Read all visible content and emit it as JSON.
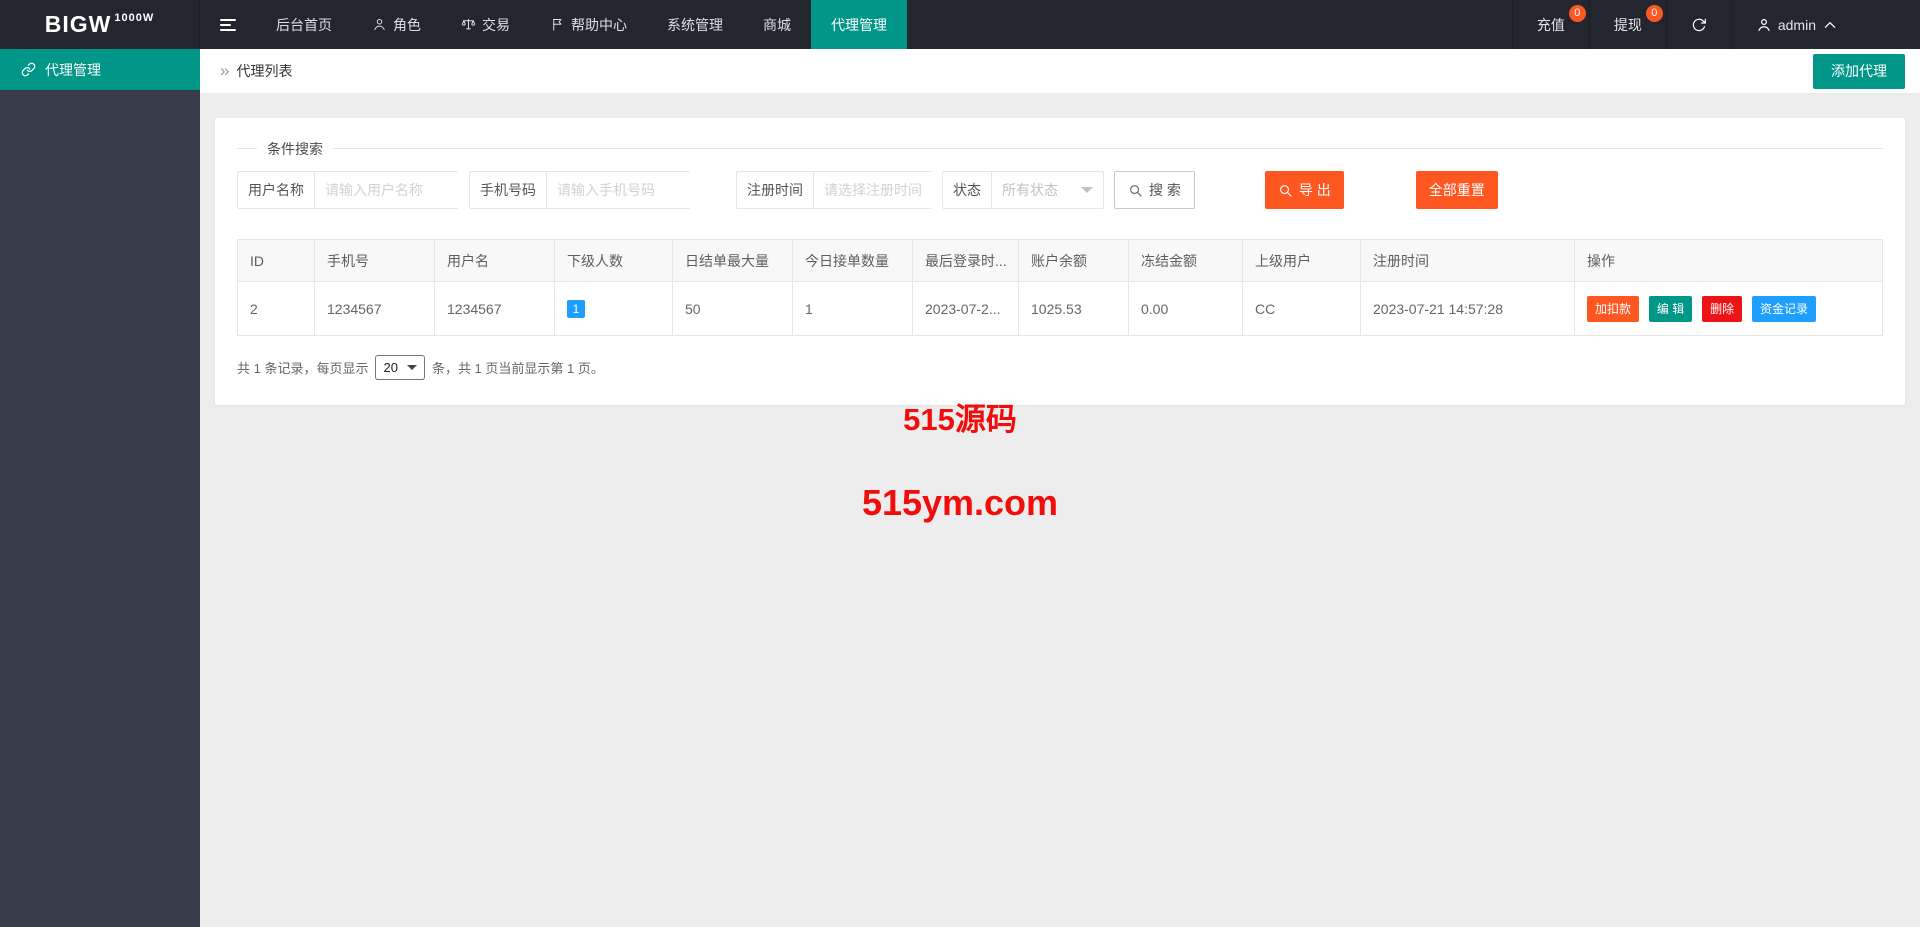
{
  "colors": {
    "accent_teal": "#009688",
    "accent_orange": "#FF5722",
    "accent_blue": "#1E9FFF",
    "accent_red": "#EC1414",
    "header_dark": "#23262E",
    "sidebar_dark": "#393D49",
    "watermark_red": "#F20D0D"
  },
  "brand": {
    "name": "BIGW",
    "superscript": "1000W"
  },
  "topnav": {
    "items": [
      {
        "label": "后台首页",
        "icon": "none"
      },
      {
        "label": "角色",
        "icon": "user-icon"
      },
      {
        "label": "交易",
        "icon": "scales-icon"
      },
      {
        "label": "帮助中心",
        "icon": "flag-icon"
      },
      {
        "label": "系统管理",
        "icon": "none"
      },
      {
        "label": "商城",
        "icon": "none"
      },
      {
        "label": "代理管理",
        "icon": "none",
        "active": true
      }
    ],
    "right": {
      "recharge": {
        "label": "充值",
        "badge": "0"
      },
      "withdraw": {
        "label": "提现",
        "badge": "0"
      },
      "refresh_icon": "refresh-icon",
      "user": {
        "icon": "user-icon",
        "name": "admin",
        "chevron": "chevron-up-icon"
      }
    }
  },
  "sidebar": {
    "items": [
      {
        "label": "代理管理",
        "icon": "link-icon",
        "active": true
      }
    ]
  },
  "toolbar": {
    "breadcrumb_icon": "»",
    "breadcrumb": "代理列表",
    "add_button": "添加代理"
  },
  "search": {
    "legend": "条件搜索",
    "fields": [
      {
        "label": "用户名称",
        "placeholder": "请输入用户名称"
      },
      {
        "label": "手机号码",
        "placeholder": "请输入手机号码"
      },
      {
        "label": "注册时间",
        "placeholder": "请选择注册时间"
      },
      {
        "label": "状态",
        "value": "所有状态",
        "type": "select"
      }
    ],
    "buttons": {
      "search": "搜 索",
      "export": "导 出",
      "reset": "全部重置"
    }
  },
  "table": {
    "headers": [
      "ID",
      "手机号",
      "用户名",
      "下级人数",
      "日结单最大量",
      "今日接单数量",
      "最后登录时...",
      "账户余额",
      "冻结金额",
      "上级用户",
      "注册时间",
      "操作"
    ],
    "rows": [
      {
        "id": "2",
        "phone": "1234567",
        "username": "1234567",
        "subordinates": "1",
        "daily_max": "50",
        "today_orders": "1",
        "last_login": "2023-07-2...",
        "balance": "1025.53",
        "frozen": "0.00",
        "parent_user": "CC",
        "register_time": "2023-07-21 14:57:28",
        "actions": [
          "加扣款",
          "编 辑",
          "删除",
          "资金记录"
        ]
      }
    ]
  },
  "pagination": {
    "prefix": "共 1 条记录，每页显示",
    "page_size": "20",
    "suffix": "条，共 1 页当前显示第 1 页。"
  },
  "watermark": {
    "line1": "515源码",
    "line2": "515ym.com"
  }
}
